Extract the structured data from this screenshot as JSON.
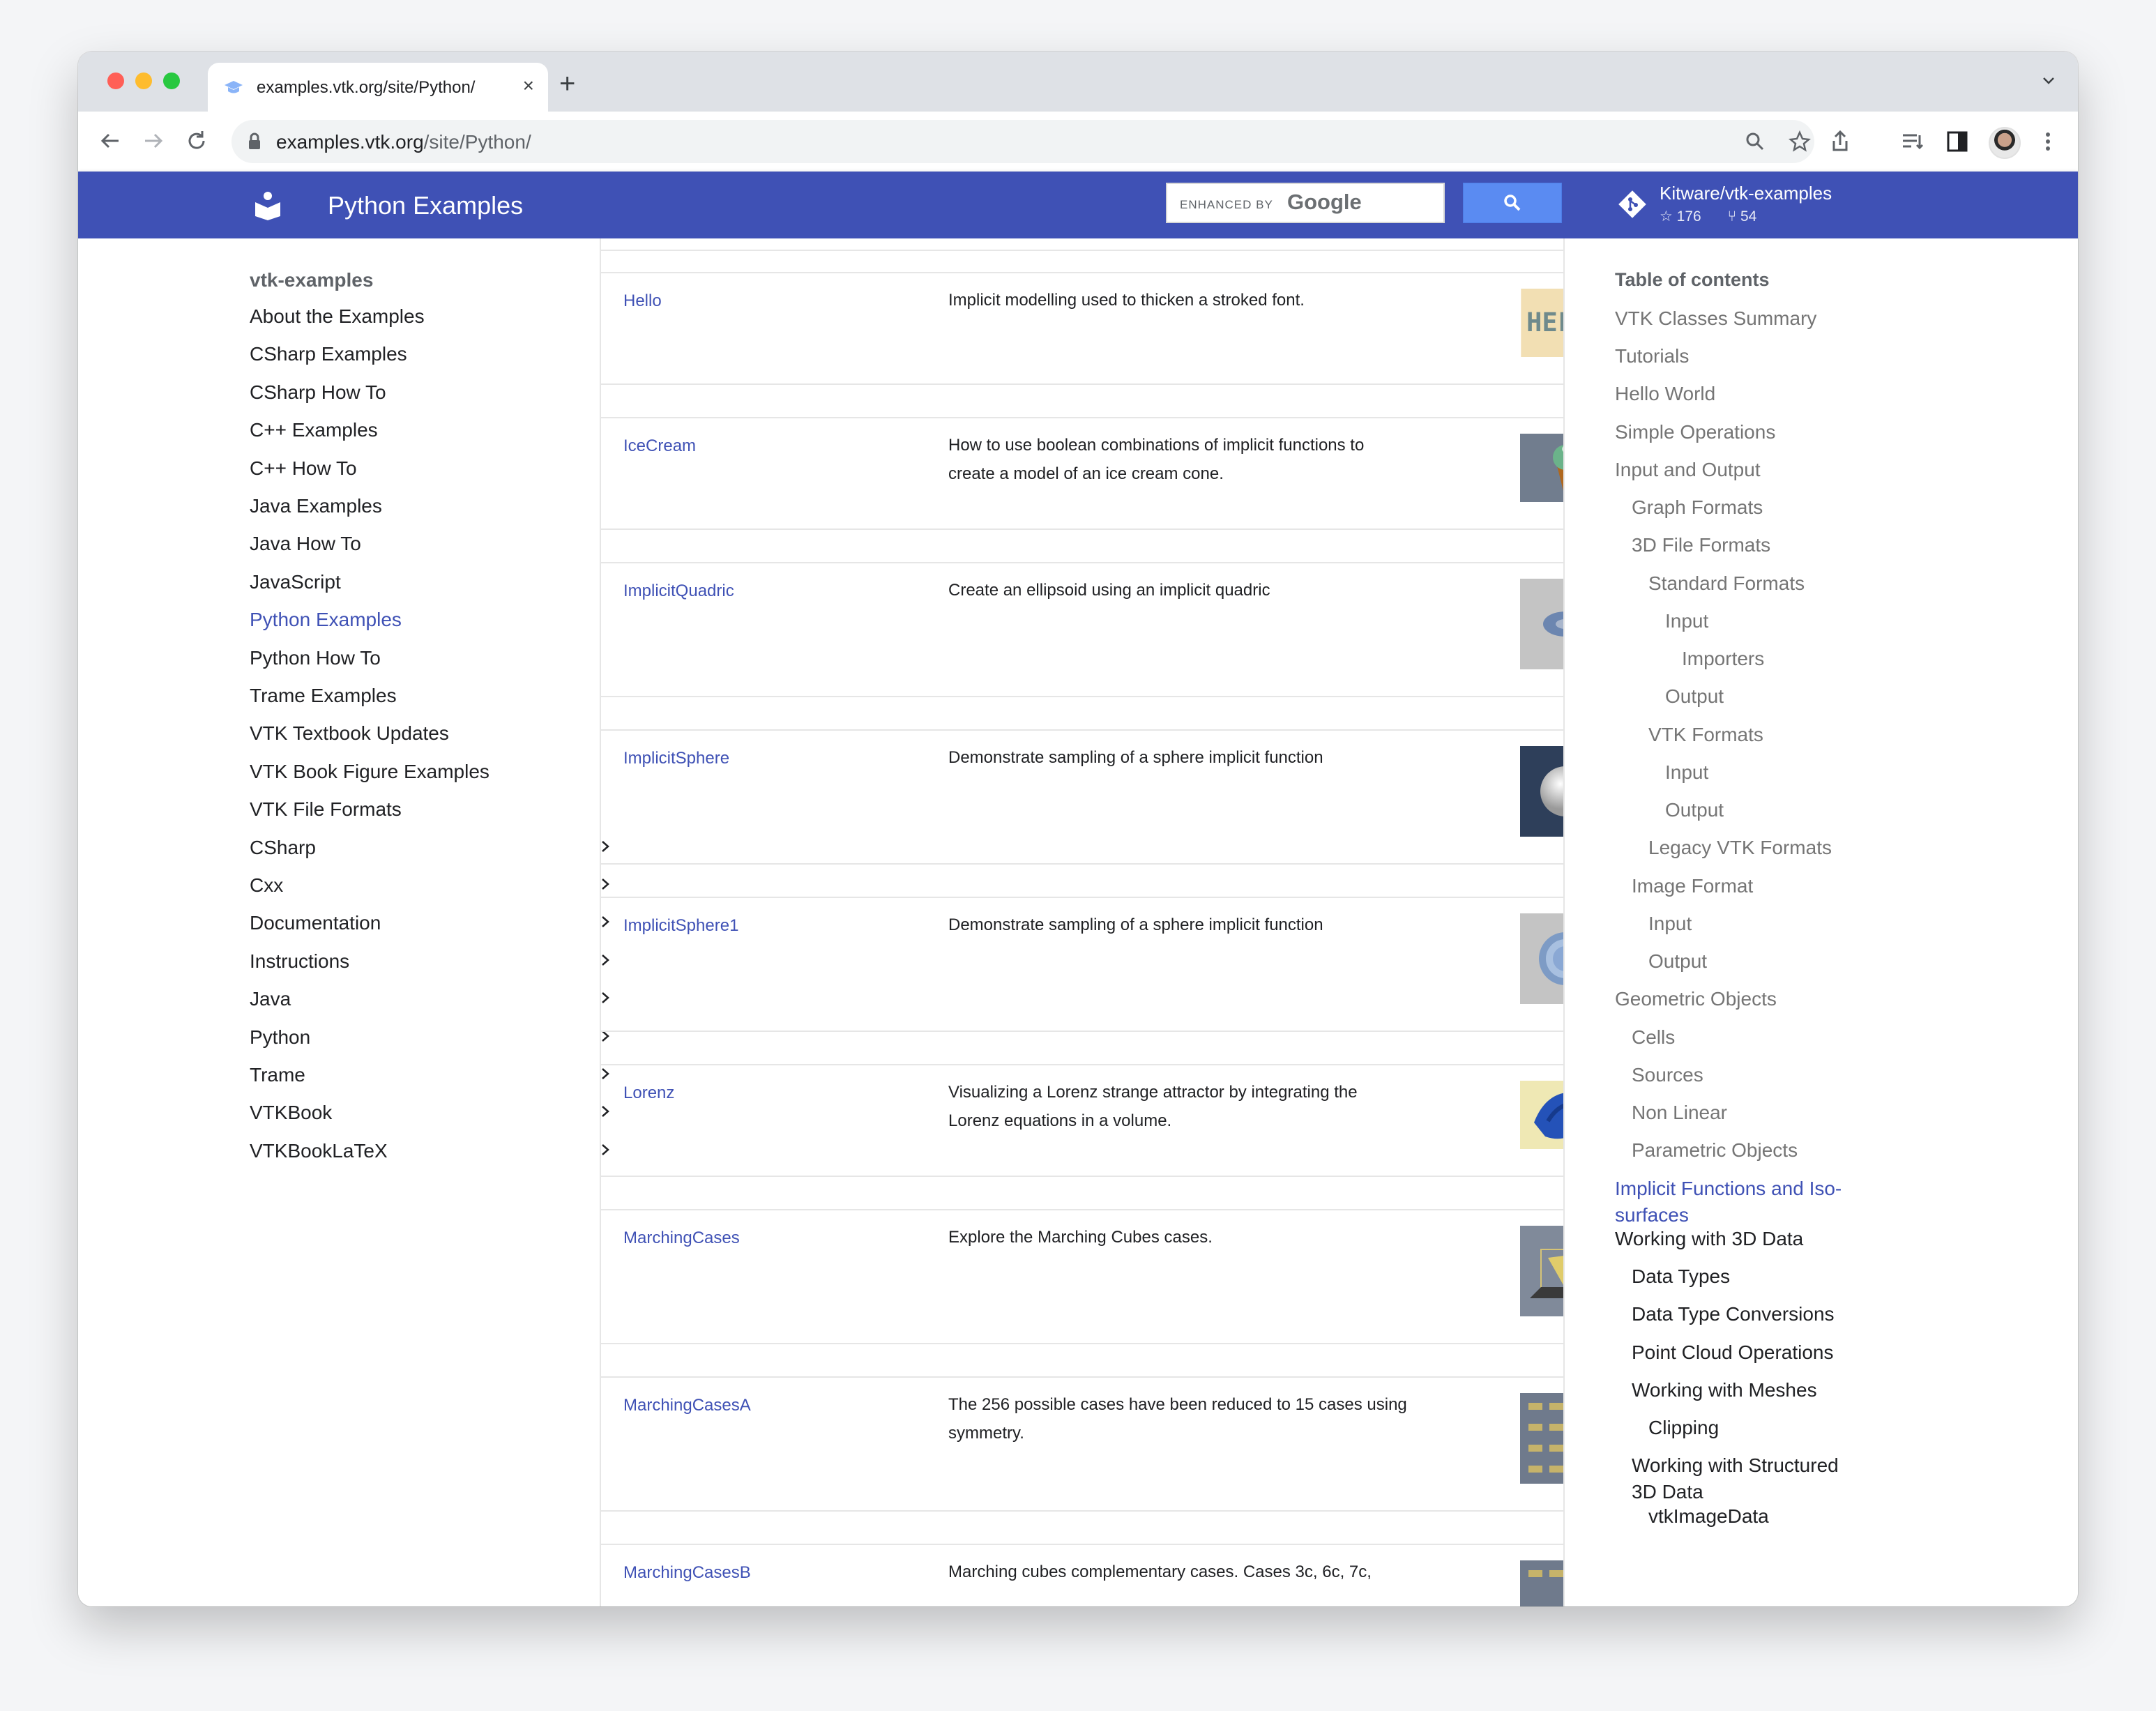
{
  "browser": {
    "tab_title": "examples.vtk.org/site/Python/",
    "url_host": "examples.vtk.org",
    "url_path": "/site/Python/"
  },
  "header": {
    "site_title": "Python Examples",
    "search_enhanced": "ENHANCED BY",
    "search_brand": "Google",
    "repo_name": "Kitware/vtk-examples",
    "repo_stars": "176",
    "repo_forks": "54",
    "color": "#3f51b5"
  },
  "left_nav": {
    "heading": "vtk-examples",
    "items": [
      {
        "label": "About the Examples"
      },
      {
        "label": "CSharp Examples"
      },
      {
        "label": "CSharp How To"
      },
      {
        "label": "C++ Examples"
      },
      {
        "label": "C++ How To"
      },
      {
        "label": "Java Examples"
      },
      {
        "label": "Java How To"
      },
      {
        "label": "JavaScript"
      },
      {
        "label": "Python Examples",
        "active": true
      },
      {
        "label": "Python How To"
      },
      {
        "label": "Trame Examples"
      },
      {
        "label": "VTK Textbook Updates"
      },
      {
        "label": "VTK Book Figure Examples"
      },
      {
        "label": "VTK File Formats"
      },
      {
        "label": "CSharp",
        "expandable": true
      },
      {
        "label": "Cxx",
        "expandable": true
      },
      {
        "label": "Documentation",
        "expandable": true
      },
      {
        "label": "Instructions",
        "expandable": true
      },
      {
        "label": "Java",
        "expandable": true
      },
      {
        "label": "Python",
        "expandable": true
      },
      {
        "label": "Trame",
        "expandable": true
      },
      {
        "label": "VTKBook",
        "expandable": true
      },
      {
        "label": "VTKBookLaTeX",
        "expandable": true
      }
    ]
  },
  "examples": [
    {
      "name": "Hello",
      "description": "Implicit modelling used to thicken a stroked font.",
      "thumb_text": "HELLO"
    },
    {
      "name": "IceCream",
      "description": "How to use boolean combinations of implicit functions to create a model of an ice cream cone."
    },
    {
      "name": "ImplicitQuadric",
      "description": "Create an ellipsoid using an implicit quadric"
    },
    {
      "name": "ImplicitSphere",
      "description": "Demonstrate sampling of a sphere implicit function"
    },
    {
      "name": "ImplicitSphere1",
      "description": "Demonstrate sampling of a sphere implicit function"
    },
    {
      "name": "Lorenz",
      "description": "Visualizing a Lorenz strange attractor by integrating the Lorenz equations in a volume."
    },
    {
      "name": "MarchingCases",
      "description": "Explore the Marching Cubes cases."
    },
    {
      "name": "MarchingCasesA",
      "description": "The 256 possible cases have been reduced to 15 cases using symmetry."
    },
    {
      "name": "MarchingCasesB",
      "description": "Marching cubes complementary cases. Cases 3c, 6c, 7c,"
    }
  ],
  "toc": {
    "heading": "Table of contents",
    "items": [
      {
        "label": "VTK Classes Summary"
      },
      {
        "label": "Tutorials"
      },
      {
        "label": "Hello World"
      },
      {
        "label": "Simple Operations"
      },
      {
        "label": "Input and Output"
      },
      {
        "label": "Graph Formats"
      },
      {
        "label": "3D File Formats"
      },
      {
        "label": "Standard Formats"
      },
      {
        "label": "Input"
      },
      {
        "label": "Importers"
      },
      {
        "label": "Output"
      },
      {
        "label": "VTK Formats"
      },
      {
        "label": "Input"
      },
      {
        "label": "Output"
      },
      {
        "label": "Legacy VTK Formats"
      },
      {
        "label": "Image Format"
      },
      {
        "label": "Input"
      },
      {
        "label": "Output"
      },
      {
        "label": "Geometric Objects"
      },
      {
        "label": "Cells"
      },
      {
        "label": "Sources"
      },
      {
        "label": "Non Linear"
      },
      {
        "label": "Parametric Objects"
      },
      {
        "label": "Implicit Functions and Iso-surfaces",
        "active": true
      },
      {
        "label": "Working with 3D Data"
      },
      {
        "label": "Data Types"
      },
      {
        "label": "Data Type Conversions"
      },
      {
        "label": "Point Cloud Operations"
      },
      {
        "label": "Working with Meshes"
      },
      {
        "label": "Clipping"
      },
      {
        "label": "Working with Structured 3D Data"
      },
      {
        "label": "vtkImageData"
      }
    ]
  }
}
